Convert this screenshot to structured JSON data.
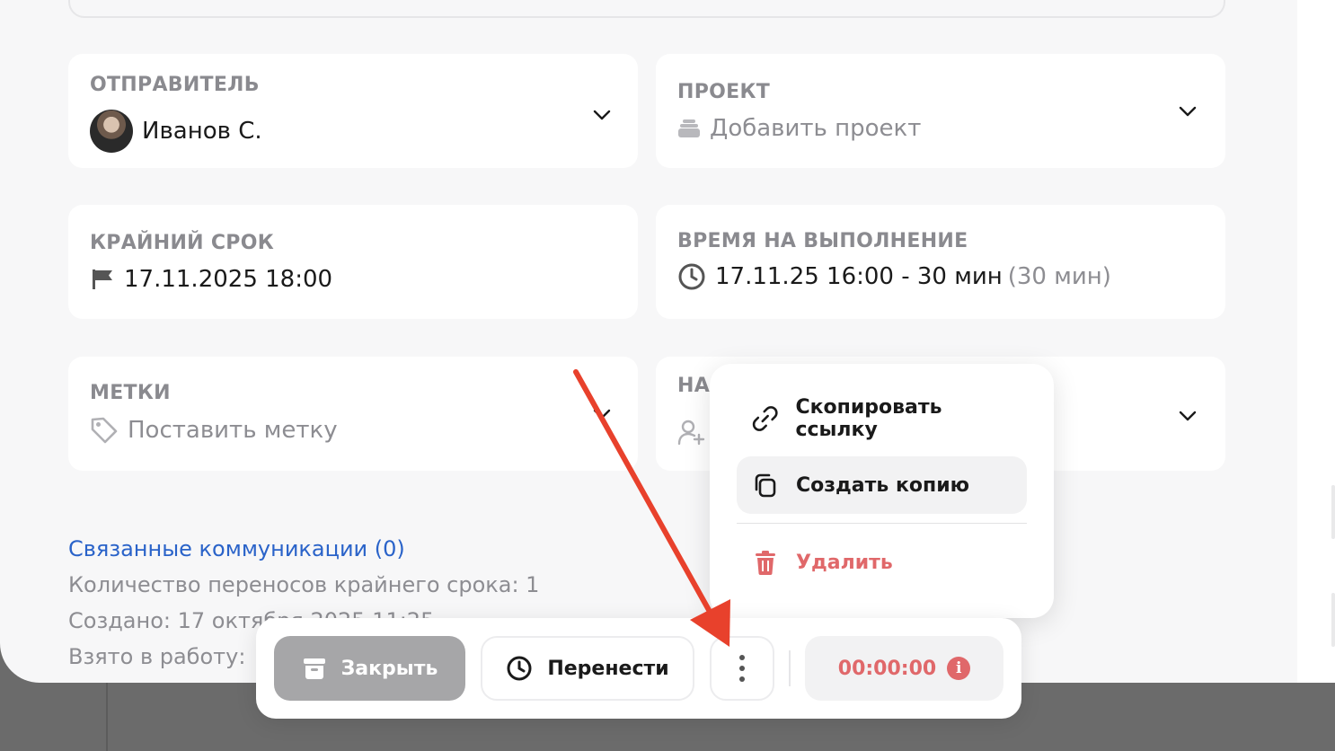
{
  "sender": {
    "label": "ОТПРАВИТЕЛЬ",
    "value": "Иванов С."
  },
  "project": {
    "label": "ПРОЕКТ",
    "placeholder": "Добавить проект"
  },
  "deadline": {
    "label": "КРАЙНИЙ СРОК",
    "value": "17.11.2025 18:00"
  },
  "exec_time": {
    "label": "ВРЕМЯ НА ВЫПОЛНЕНИЕ",
    "value": "17.11.25 16:00 - 30 мин",
    "duration": "(30 мин)"
  },
  "tags": {
    "label": "МЕТКИ",
    "placeholder": "Поставить метку"
  },
  "assignee": {
    "label_partial": "НА"
  },
  "related_link": "Связанные коммуникации (0)",
  "meta": {
    "reschedules": "Количество переносов крайнего срока: 1",
    "created": "Создано: 17 октября 2025 11:25",
    "taken": "Взято в работу:"
  },
  "context_menu": {
    "copy_link": "Скопировать ссылку",
    "create_copy": "Создать копию",
    "delete": "Удалить"
  },
  "bottom_bar": {
    "close_label": "Закрыть",
    "move_label": "Перенести",
    "timer": "00:00:00"
  },
  "colors": {
    "accent_link": "#2a63c9",
    "danger": "#e0686a",
    "arrow": "#e8412c"
  }
}
